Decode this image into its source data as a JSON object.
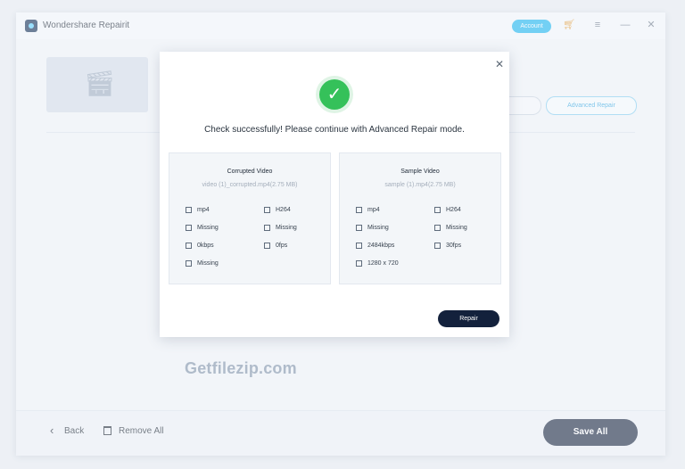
{
  "window": {
    "title": "Wondershare Repairit",
    "account_label": "Account",
    "icons": {
      "app": "repairit-logo-icon",
      "cart": "cart-icon",
      "menu": "menu-icon",
      "minimize": "minimize-icon",
      "close": "close-icon"
    }
  },
  "background": {
    "advanced_repair_label": "Advanced Repair",
    "watermark": "Getfilezip.com",
    "footer": {
      "back_label": "Back",
      "remove_all_label": "Remove All",
      "save_all_label": "Save All"
    }
  },
  "dialog": {
    "message": "Check successfully! Please continue with Advanced Repair mode.",
    "success_icon": "success-check-icon",
    "repair_label": "Repair",
    "corrupted": {
      "title": "Corrupted Video",
      "file": "video (1)_corrupted.mp4(2.75 MB)",
      "format": "mp4",
      "codec": "H264",
      "resolution_status": "Missing",
      "audio_status": "Missing",
      "bitrate": "0kbps",
      "fps": "0fps",
      "dimension": "Missing"
    },
    "sample": {
      "title": "Sample Video",
      "file": "sample (1).mp4(2.75 MB)",
      "format": "mp4",
      "codec": "H264",
      "resolution_status": "Missing",
      "audio_status": "Missing",
      "bitrate": "2484kbps",
      "fps": "30fps",
      "dimension": "1280 x 720"
    }
  },
  "colors": {
    "accent": "#18b6f0",
    "primary_dark": "#13213c",
    "success": "#35c15a",
    "background": "#f1f5f9"
  }
}
